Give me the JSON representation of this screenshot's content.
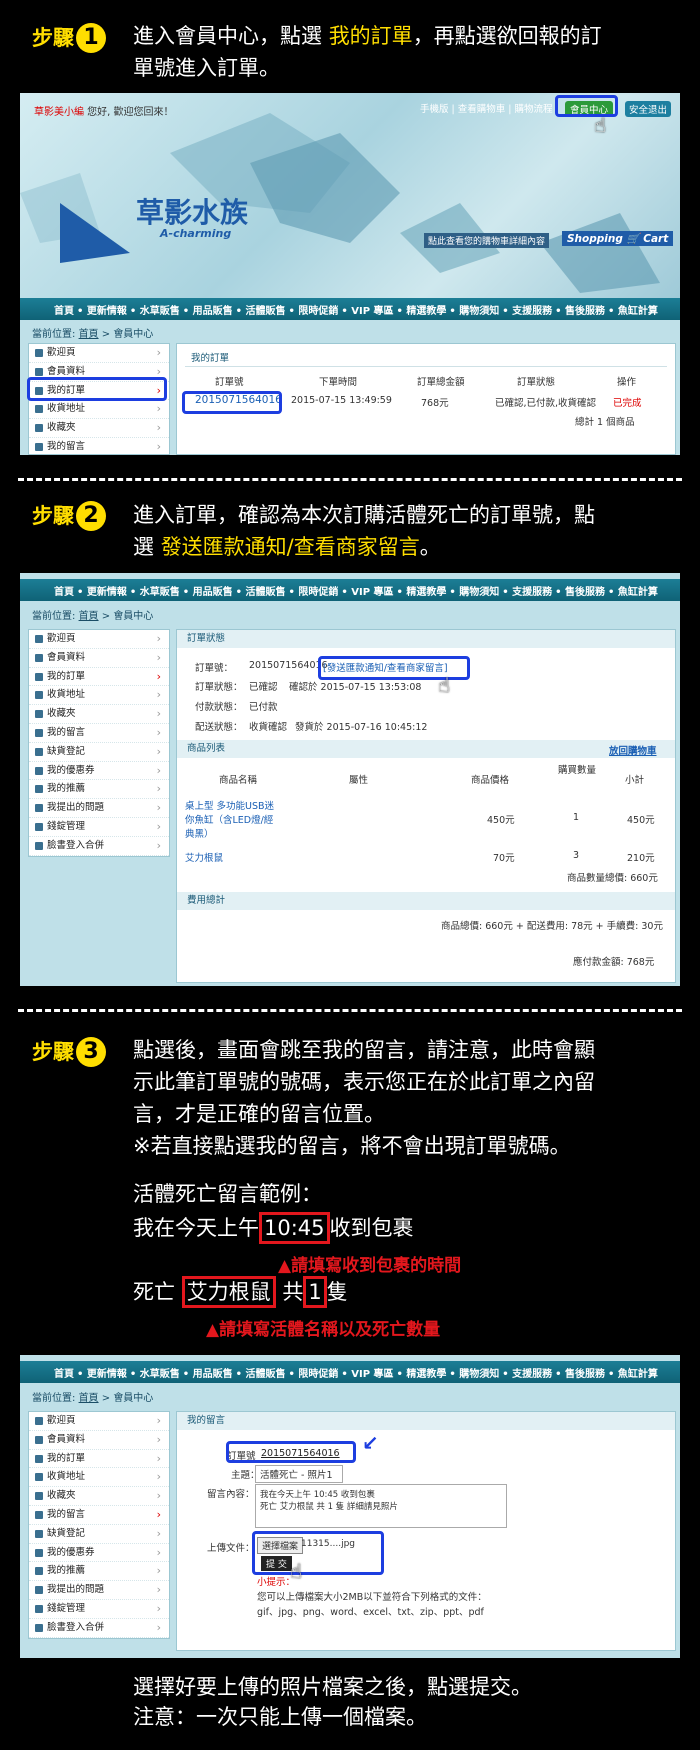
{
  "step1": {
    "word": "步驟",
    "num": "1",
    "text_a": "進入會員中心，點選 ",
    "text_hl": "我的訂單",
    "text_b": "，再點選欲回報的訂",
    "text_c": "單號進入訂單。"
  },
  "shot1": {
    "greeting_name": "草影美小編",
    "greeting_text": " 您好, 歡迎您回來！",
    "toplinks": [
      "手機版",
      "查看購物車",
      "購物流程"
    ],
    "member_center": "會員中心",
    "logout": "安全退出",
    "brand_cn": "草影水族",
    "brand_en": "A-charming",
    "cart_hint": "點此查看您的購物車詳細內容",
    "cart_label": "Shopping 🛒 Cart"
  },
  "nav": [
    "首頁",
    "• 更新情報",
    "• 水草販售",
    "• 用品販售",
    "• 活體販售",
    "• 限時促銷",
    "• VIP 專區",
    "• 精選教學",
    "• 購物須知",
    "• 支援服務",
    "• 售後服務",
    "• 魚缸計算"
  ],
  "breadcrumb": {
    "prefix": "當前位置: ",
    "home": "首頁",
    "sep": " > ",
    "current": "會員中心"
  },
  "sidebar1": [
    "歡迎頁",
    "會員資料",
    "我的訂單",
    "收貨地址",
    "收藏夾",
    "我的留言"
  ],
  "sidebar_full": [
    "歡迎頁",
    "會員資料",
    "我的訂單",
    "收貨地址",
    "收藏夾",
    "我的留言",
    "缺貨登記",
    "我的優惠券",
    "我的推薦",
    "我提出的問題",
    "錢錠管理",
    "臉書登入合併"
  ],
  "orders": {
    "title": "我的訂單",
    "headers": [
      "訂單號",
      "下單時間",
      "訂單總金額",
      "訂單狀態",
      "操作"
    ],
    "row": {
      "id": "2015071564016",
      "time": "2015-07-15 13:49:59",
      "amount": "768元",
      "status": "已確認,已付款,收貨確認",
      "op": "已完成"
    },
    "total": "總計 1 個商品"
  },
  "step2": {
    "word": "步驟",
    "num": "2",
    "text_a": "進入訂單，確認為本次訂購活體死亡的訂單號，點",
    "text_b": "選 ",
    "text_hl": "發送匯款通知/查看商家留言",
    "text_c": "。"
  },
  "order_detail": {
    "title": "訂單狀態",
    "labels": [
      "訂單號：",
      "訂單狀態：",
      "付款狀態：",
      "配送狀態："
    ],
    "order_no": "2015071564016",
    "notify_link": "[發送匯款通知/查看商家留言]",
    "status": "已確認",
    "status_note": "確認於 2015-07-15 13:53:08",
    "pay": "已付款",
    "ship": "收貨確認",
    "ship_note": "發貨於 2015-07-16 10:45:12",
    "products_title": "商品列表",
    "back_cart": "放回購物車",
    "p_headers": [
      "商品名稱",
      "屬性",
      "商品價格",
      "購買數量",
      "小計"
    ],
    "products": [
      {
        "name_1": "桌上型 多功能USB迷",
        "name_2": "你魚缸（含LED燈/經",
        "name_3": "典黑）",
        "price": "450元",
        "qty": "1",
        "sub": "450元"
      },
      {
        "name_1": "艾力根鼠",
        "name_2": "",
        "name_3": "",
        "price": "70元",
        "qty": "3",
        "sub": "210元"
      }
    ],
    "products_total": "商品數量總價: 660元",
    "fee_title": "費用總計",
    "fee_line": "商品總價: 660元 + 配送費用: 78元 + 手續費: 30元",
    "pay_total": "應付款金額: 768元"
  },
  "step3": {
    "word": "步驟",
    "num": "3",
    "lines": [
      "點選後，畫面會跳至我的留言，請注意，此時會顯",
      "示此筆訂單號的號碼，表示您正在於此訂單之內留",
      "言，才是正確的留言位置。",
      "※若直接點選我的留言，將不會出現訂單號碼。"
    ],
    "example_title": "活體死亡留言範例：",
    "ex1_a": "我在今天上午",
    "ex1_time": "10:45",
    "ex1_b": "收到包裹",
    "note1": "▲請填寫收到包裹的時間",
    "ex2_a": "死亡 ",
    "ex2_name": "艾力根鼠",
    "ex2_b": " 共",
    "ex2_qty": "1",
    "ex2_c": "隻",
    "note2": "▲請填寫活體名稱以及死亡數量"
  },
  "message": {
    "title": "我的留言",
    "order_label": "訂單號",
    "order_no": "2015071564016",
    "subject_label": "主題：",
    "subject": "活體死亡 - 照片1",
    "content_label": "留言內容：",
    "content_1": "我在今天上午 10:45 收到包裹",
    "content_2": "死亡 艾力根鼠 共 1 隻 詳細請見照片",
    "upload_label": "上傳文件：",
    "choose": "選擇檔案",
    "filename": "11315....jpg",
    "submit": "提 交",
    "tip_title": "小提示：",
    "tip_1": "您可以上傳檔案大小2MB以下並符合下列格式的文件：",
    "tip_2": "gif、jpg、png、word、excel、txt、zip、ppt、pdf"
  },
  "footer": {
    "line1": "選擇好要上傳的照片檔案之後，點選提交。",
    "line2": "注意：一次只能上傳一個檔案。"
  },
  "colors": {
    "accent_yellow": "#ffde00",
    "highlight_blue": "#1d3ee0",
    "note_red": "#e3171d"
  }
}
